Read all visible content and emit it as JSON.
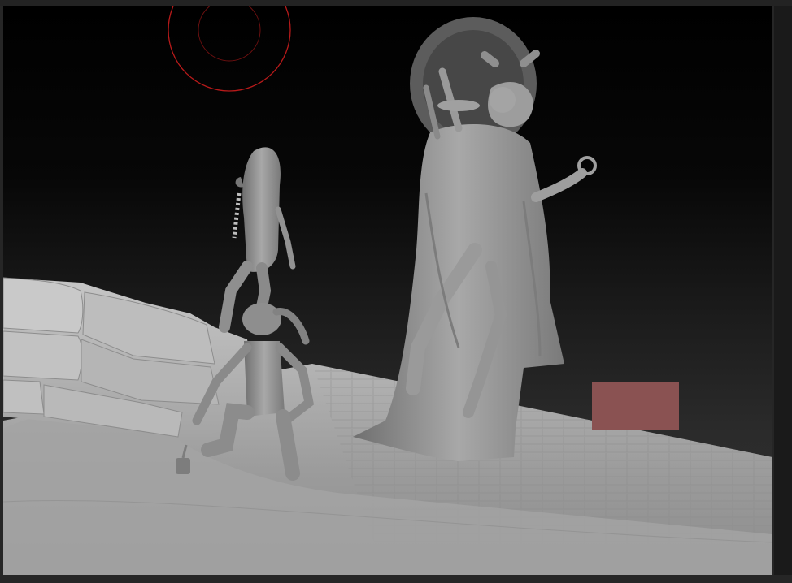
{
  "colors": {
    "background": "#262626",
    "sculpt_clay": "#9a9a9a",
    "brush_cursor": "#b81a1a",
    "selection_box": "#8a5252"
  },
  "icons": {
    "brush_cursor": "brush-radius-circle-icon",
    "selection": "rectangle-marker-icon"
  }
}
